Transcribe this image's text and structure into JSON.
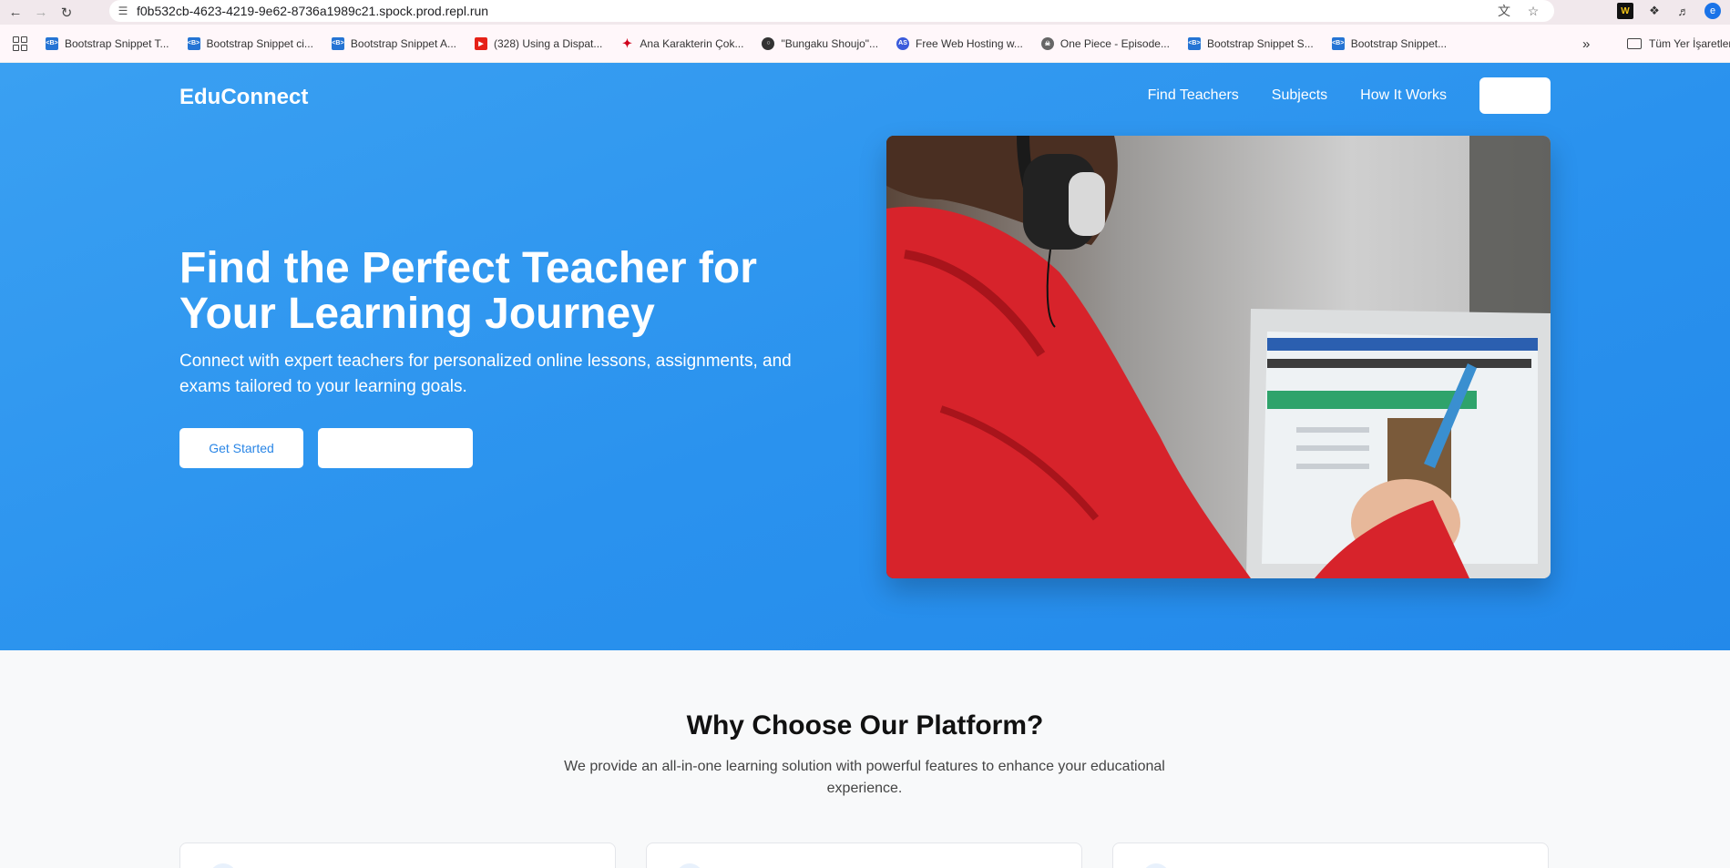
{
  "browser": {
    "url": "f0b532cb-4623-4219-9e62-8736a1989c21.spock.prod.repl.run",
    "avatar_letter": "e",
    "bookmarks": [
      {
        "label": "Bootstrap Snippet T...",
        "icon": "bootstrap-icon"
      },
      {
        "label": "Bootstrap Snippet ci...",
        "icon": "bootstrap-icon"
      },
      {
        "label": "Bootstrap Snippet A...",
        "icon": "bootstrap-icon"
      },
      {
        "label": "(328) Using a Dispat...",
        "icon": "youtube-icon"
      },
      {
        "label": "Ana Karakterin Çok...",
        "icon": "bird-icon"
      },
      {
        "label": "\"Bungaku Shoujo\"...",
        "icon": "globe-icon"
      },
      {
        "label": "Free Web Hosting w...",
        "icon": "as-icon"
      },
      {
        "label": "One Piece - Episode...",
        "icon": "onepiece-icon"
      },
      {
        "label": "Bootstrap Snippet S...",
        "icon": "bootstrap-icon"
      },
      {
        "label": "Bootstrap Snippet...",
        "icon": "bootstrap-icon"
      }
    ],
    "bookmarks_folder": "Tüm Yer İşaretler"
  },
  "nav": {
    "logo": "EduConnect",
    "links": [
      "Find Teachers",
      "Subjects",
      "How It Works"
    ]
  },
  "hero": {
    "title": "Find the Perfect Teacher for Your Learning Journey",
    "subtitle": "Connect with expert teachers for personalized online lessons, assignments, and exams tailored to your learning goals.",
    "primary_button": "Get Started"
  },
  "features": {
    "title": "Why Choose Our Platform?",
    "subtitle": "We provide an all-in-one learning solution with powerful features to enhance your educational experience."
  },
  "colors": {
    "hero_blue": "#2a92ee",
    "button_text_blue": "#2a86e6"
  }
}
